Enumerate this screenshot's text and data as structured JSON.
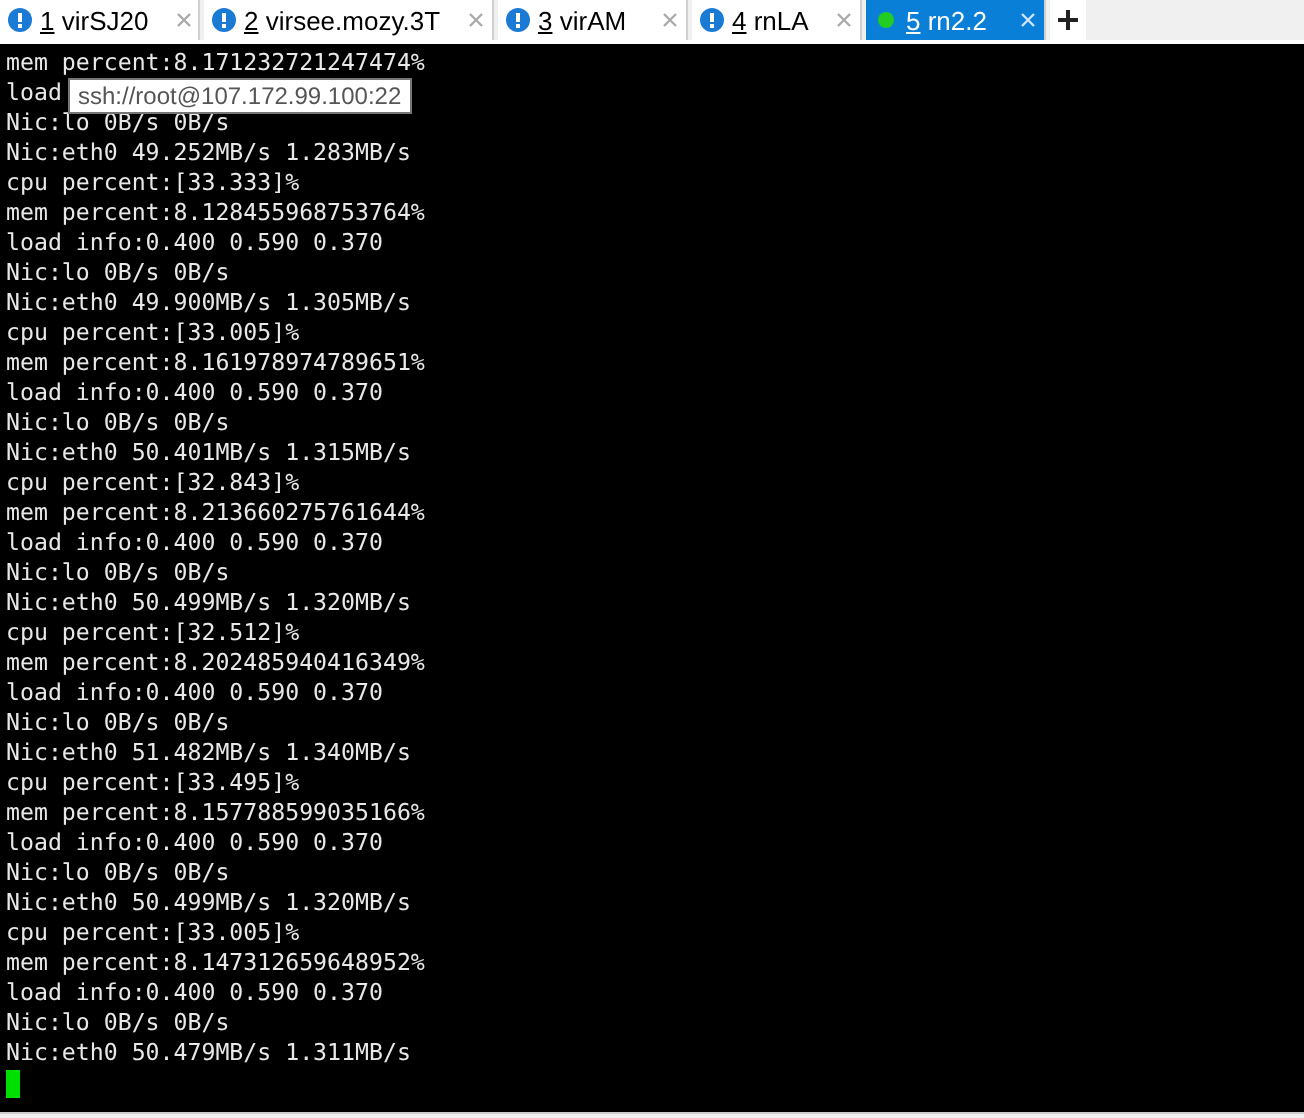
{
  "tabs": [
    {
      "number": "1",
      "label": "virSJ20",
      "kind": "alert",
      "selected": false
    },
    {
      "number": "2",
      "label": "virsee.mozy.3T",
      "kind": "alert",
      "selected": false
    },
    {
      "number": "3",
      "label": "virAM",
      "kind": "alert",
      "selected": false
    },
    {
      "number": "4",
      "label": "rnLA",
      "kind": "alert",
      "selected": false
    },
    {
      "number": "5",
      "label": "rn2.2",
      "kind": "connected",
      "selected": true
    }
  ],
  "tooltip": "ssh://root@107.172.99.100:22",
  "terminal": {
    "lines": [
      "mem percent:8.171232721247474%",
      "load",
      "Nic:lo 0B/s 0B/s",
      "Nic:eth0 49.252MB/s 1.283MB/s",
      "cpu percent:[33.333]%",
      "mem percent:8.128455968753764%",
      "load info:0.400 0.590 0.370",
      "Nic:lo 0B/s 0B/s",
      "Nic:eth0 49.900MB/s 1.305MB/s",
      "cpu percent:[33.005]%",
      "mem percent:8.161978974789651%",
      "load info:0.400 0.590 0.370",
      "Nic:lo 0B/s 0B/s",
      "Nic:eth0 50.401MB/s 1.315MB/s",
      "cpu percent:[32.843]%",
      "mem percent:8.213660275761644%",
      "load info:0.400 0.590 0.370",
      "Nic:lo 0B/s 0B/s",
      "Nic:eth0 50.499MB/s 1.320MB/s",
      "cpu percent:[32.512]%",
      "mem percent:8.202485940416349%",
      "load info:0.400 0.590 0.370",
      "Nic:lo 0B/s 0B/s",
      "Nic:eth0 51.482MB/s 1.340MB/s",
      "cpu percent:[33.495]%",
      "mem percent:8.157788599035166%",
      "load info:0.400 0.590 0.370",
      "Nic:lo 0B/s 0B/s",
      "Nic:eth0 50.499MB/s 1.320MB/s",
      "cpu percent:[33.005]%",
      "mem percent:8.147312659648952%",
      "load info:0.400 0.590 0.370",
      "Nic:lo 0B/s 0B/s",
      "Nic:eth0 50.479MB/s 1.311MB/s"
    ]
  }
}
